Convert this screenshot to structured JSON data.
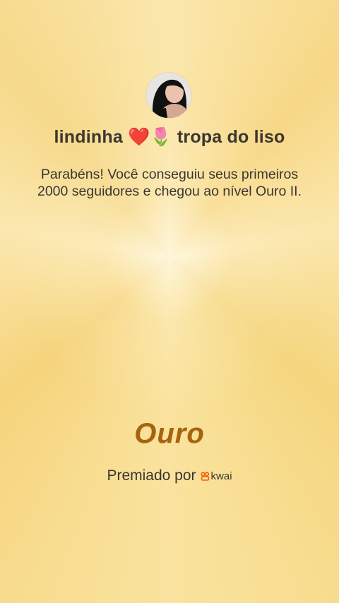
{
  "profile": {
    "username": "lindinha ❤️🌷 tropa do liso"
  },
  "message": "Parabéns! Você conseguiu seus primeiros 2000 seguidores e chegou ao nível Ouro II.",
  "level": {
    "name": "Ouro"
  },
  "award": {
    "prefix": "Premiado por",
    "brand": "kwai",
    "brand_color": "#ff5a00"
  },
  "theme": {
    "background": "#f8dc92",
    "level_color": "#a8620f",
    "text_color": "#3a3631"
  }
}
